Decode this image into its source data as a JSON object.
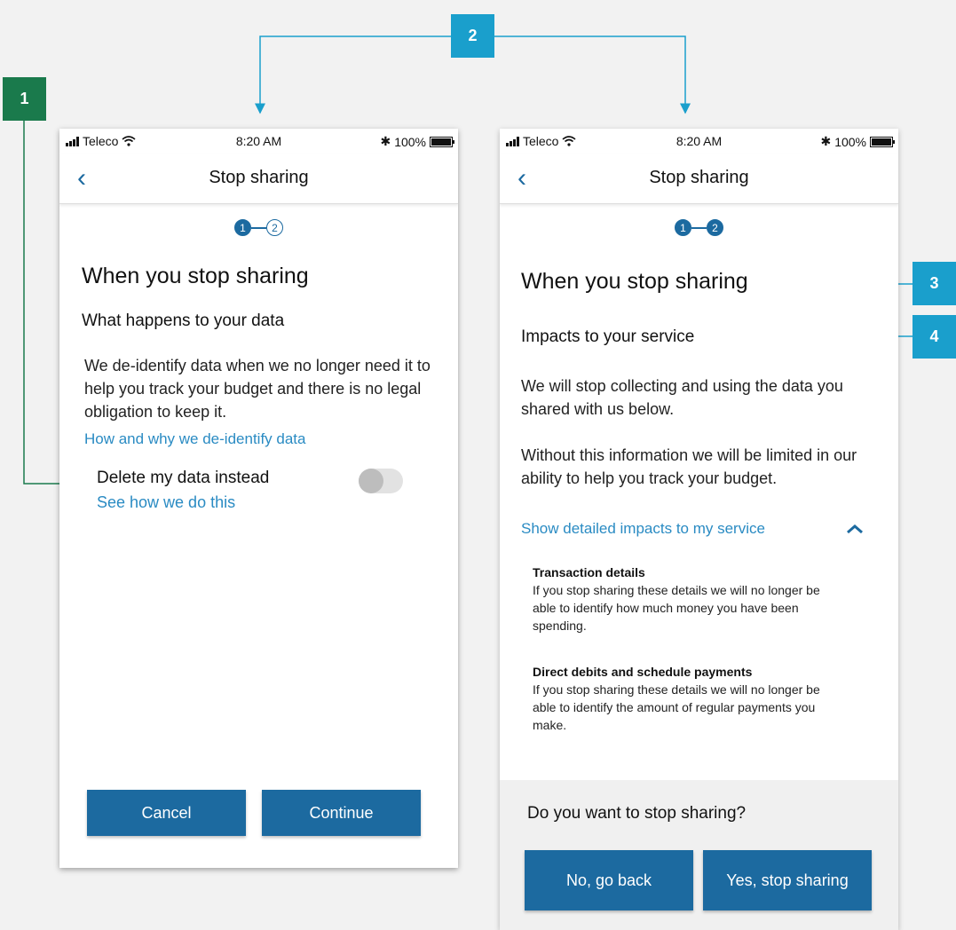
{
  "annotations": {
    "badge1": "1",
    "badge2": "2",
    "badge3": "3",
    "badge4": "4",
    "colors": {
      "green": "#1a7a4c",
      "blue": "#1a9fcc"
    }
  },
  "status_bar": {
    "carrier": "Teleco",
    "time": "8:20 AM",
    "battery": "100%"
  },
  "screen1": {
    "nav_title": "Stop sharing",
    "steps": [
      "1",
      "2"
    ],
    "current_step": 1,
    "heading": "When you stop sharing",
    "subheading": "What happens to your data",
    "body": "We de-identify data when we no longer need it to help you track your budget and there is no legal obligation to keep it.",
    "link_deidentify": "How and why we de-identify data",
    "delete_label": "Delete my data instead",
    "delete_link": "See how we do this",
    "delete_toggle_on": false,
    "cancel_button": "Cancel",
    "continue_button": "Continue"
  },
  "screen2": {
    "nav_title": "Stop sharing",
    "steps": [
      "1",
      "2"
    ],
    "current_step": 2,
    "heading": "When you stop sharing",
    "subheading": "Impacts to your service",
    "body1": "We will stop collecting and using the data you shared with us below.",
    "body2": "Without this information we will be limited in our ability to help you track your budget.",
    "show_impacts_link": "Show detailed impacts to my service",
    "impacts": [
      {
        "title": "Transaction details",
        "text": "If you stop sharing these details we will no longer be able to identify how much money you have been spending."
      },
      {
        "title": "Direct debits and schedule payments",
        "text": "If you stop sharing these details we will no longer be able to identify the amount of regular payments you make."
      }
    ],
    "question": "Do you want to stop sharing?",
    "no_button": "No, go back",
    "yes_button": "Yes, stop sharing"
  },
  "brand": {
    "primary": "#1c6aa0",
    "link": "#2a8bc3"
  }
}
